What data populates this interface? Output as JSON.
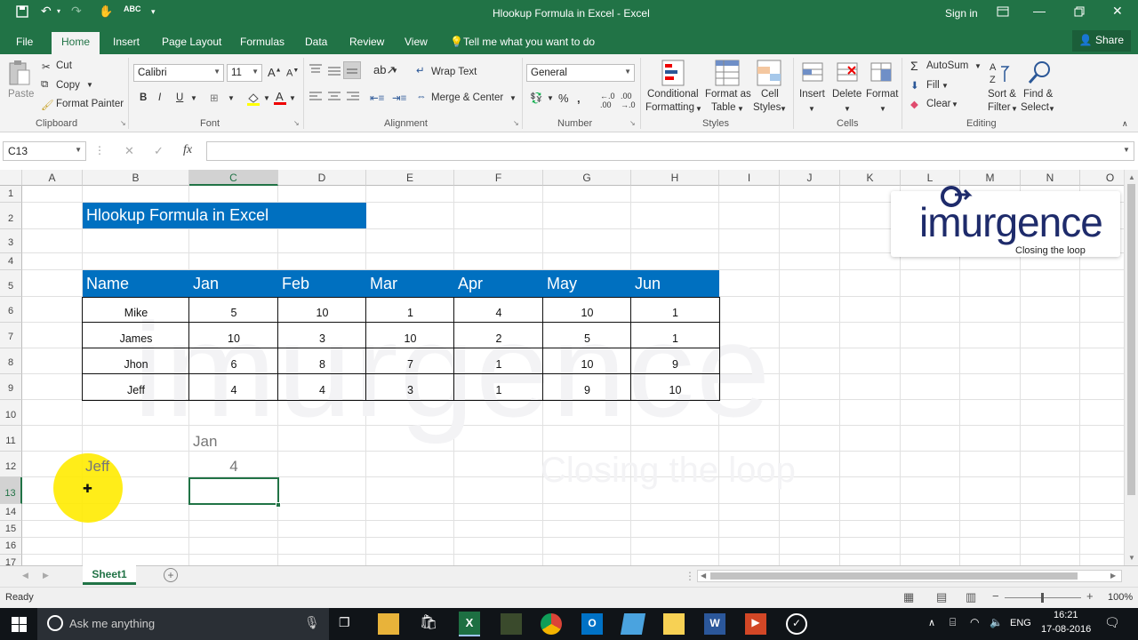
{
  "window": {
    "title": "Hlookup Formula in Excel - Excel",
    "sign_in": "Sign in"
  },
  "ribbon_tabs": [
    "File",
    "Home",
    "Insert",
    "Page Layout",
    "Formulas",
    "Data",
    "Review",
    "View"
  ],
  "active_tab": "Home",
  "tell_me": "Tell me what you want to do",
  "share": "Share",
  "clipboard": {
    "paste": "Paste",
    "cut": "Cut",
    "copy": "Copy",
    "format_painter": "Format Painter",
    "group": "Clipboard"
  },
  "font": {
    "name": "Calibri",
    "size": "11",
    "group": "Font"
  },
  "alignment": {
    "wrap_text": "Wrap Text",
    "merge_center": "Merge & Center",
    "group": "Alignment"
  },
  "number": {
    "format": "General",
    "group": "Number"
  },
  "styles": {
    "conditional_1": "Conditional",
    "conditional_2": "Formatting",
    "format_table_1": "Format as",
    "format_table_2": "Table",
    "cell_styles_1": "Cell",
    "cell_styles_2": "Styles",
    "group": "Styles"
  },
  "cells": {
    "insert": "Insert",
    "delete": "Delete",
    "format": "Format",
    "group": "Cells"
  },
  "editing": {
    "autosum": "AutoSum",
    "fill": "Fill",
    "clear": "Clear",
    "sort_1": "Sort &",
    "sort_2": "Filter",
    "find_1": "Find &",
    "find_2": "Select",
    "group": "Editing"
  },
  "formula_bar": {
    "name_box": "C13",
    "formula": ""
  },
  "columns": [
    "A",
    "B",
    "C",
    "D",
    "E",
    "F",
    "G",
    "H",
    "I",
    "J",
    "K",
    "L",
    "M",
    "N",
    "O"
  ],
  "rows": [
    "1",
    "2",
    "3",
    "4",
    "5",
    "6",
    "7",
    "8",
    "9",
    "10",
    "11",
    "12",
    "13",
    "14",
    "15",
    "16",
    "17"
  ],
  "sheet": {
    "title_cell": "Hlookup Formula  in Excel",
    "header": [
      "Name",
      "Jan",
      "Feb",
      "Mar",
      "Apr",
      "May",
      "Jun"
    ],
    "table": [
      [
        "Mike",
        "5",
        "10",
        "1",
        "4",
        "10",
        "1"
      ],
      [
        "James",
        "10",
        "3",
        "10",
        "2",
        "5",
        "1"
      ],
      [
        "Jhon",
        "6",
        "8",
        "7",
        "1",
        "10",
        "9"
      ],
      [
        "Jeff",
        "4",
        "4",
        "3",
        "1",
        "9",
        "10"
      ]
    ],
    "lookup_month": "Jan",
    "lookup_name": "Jeff",
    "lookup_result": "4"
  },
  "watermark": {
    "logo": "imurgence",
    "tagline": "Closing the loop"
  },
  "sheet_tabs": [
    "Sheet1"
  ],
  "status": {
    "ready": "Ready",
    "zoom": "100%"
  },
  "taskbar": {
    "search": "Ask me anything",
    "time": "16:21",
    "date": "17-08-2016",
    "lang": "ENG"
  },
  "colors": {
    "excel_green": "#217346",
    "table_blue": "#0070c0",
    "taskbar": "#101418"
  }
}
